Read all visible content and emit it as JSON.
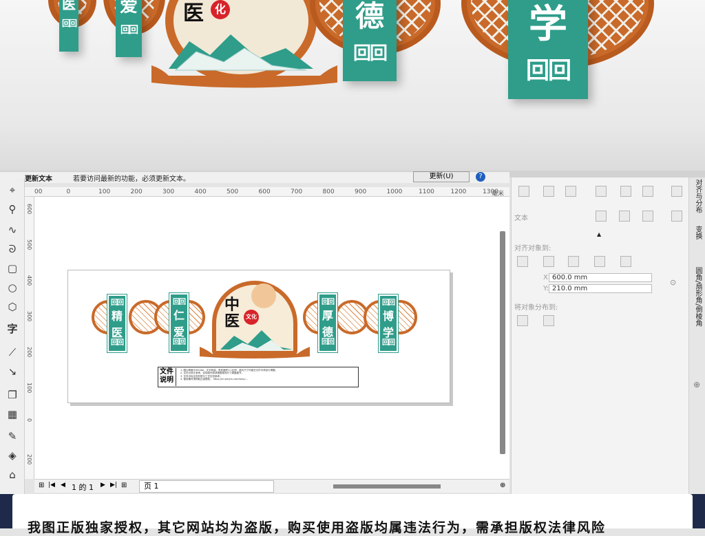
{
  "photo": {
    "medallion_big": "医",
    "medallion_small": "化",
    "plates": [
      "医",
      "爱",
      "德",
      "学"
    ],
    "pattern_glyph": "回回"
  },
  "info_bar": {
    "title": "更新文本",
    "message": "若要访问最新的功能，必须更新文本。",
    "update_button": "更新(U)",
    "help_icon": "question-icon"
  },
  "ruler": {
    "h_ticks": [
      "00",
      "0",
      "100",
      "200",
      "300",
      "400",
      "500",
      "600",
      "700",
      "800",
      "900",
      "1000",
      "1100",
      "1200",
      "1300"
    ],
    "unit": "毫米",
    "v_ticks": [
      "600",
      "500",
      "400",
      "300",
      "200",
      "100",
      "0",
      "200"
    ]
  },
  "toolbox": {
    "tools": [
      "pick-tool-icon",
      "zoom-tool-icon",
      "freehand-tool-icon",
      "bezier-tool-icon",
      "rectangle-tool-icon",
      "ellipse-tool-icon",
      "polygon-tool-icon",
      "text-tool-icon",
      "line-tool-icon",
      "connector-tool-icon",
      "shadow-tool-icon",
      "transparency-tool-icon",
      "eyedropper-tool-icon",
      "fill-tool-icon",
      "smart-fill-tool-icon"
    ],
    "text_tool_label": "字"
  },
  "design": {
    "center_big": "中",
    "center_big2": "医",
    "center_small": "文化",
    "plates": [
      {
        "top": "精",
        "bottom": "医"
      },
      {
        "top": "仁",
        "bottom": "爱"
      },
      {
        "top": "厚",
        "bottom": "德"
      },
      {
        "top": "博",
        "bottom": "学"
      }
    ],
    "pattern": "回回",
    "note_label": "文件说明",
    "note_lines": [
      "1. 图片精度为300dpi，文字转曲，有效面积1:1比例，超大尺寸可能在文件中请自行调整。",
      "2. 文件为设计参考，实际制作前请根据现场尺寸调整细节。",
      "3. 文件中标注的材质与工艺仅供参考。",
      "4. 使用素材请获取正版授权。 https://m.weiyin.com/tuku/..."
    ]
  },
  "bottom_bar": {
    "page_of": "1 的 1",
    "page_tab": "页 1"
  },
  "right_panel": {
    "section_title": "文本",
    "align_title": "对齐对象到:",
    "x_label": "X:",
    "x_value": "600.0 mm",
    "y_label": "Y:",
    "y_value": "210.0 mm",
    "distribute_title": "将对象分布到:"
  },
  "side_tabs": [
    "对齐与分布",
    "变换",
    "圆角/扇形角/倒棱角"
  ],
  "banner": {
    "text": "我图正版独家授权，其它网站均为盗版，购买使用盗版均属违法行为，需承担版权法律风险"
  }
}
